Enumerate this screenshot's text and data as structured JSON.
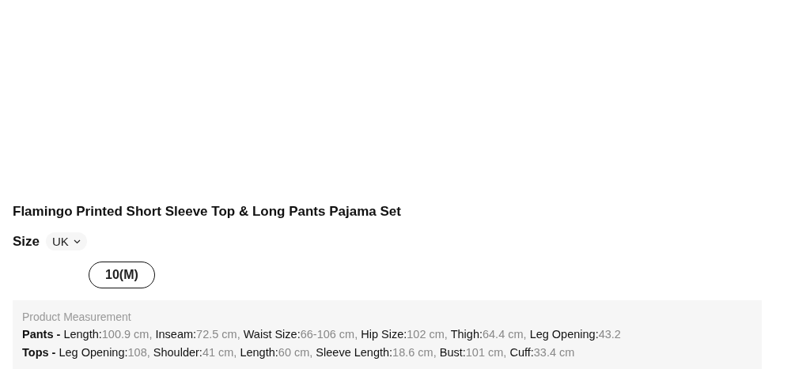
{
  "product": {
    "title": "Flamingo Printed Short Sleeve Top & Long Pants Pajama Set"
  },
  "size": {
    "label": "Size",
    "region": "UK",
    "options": [
      {
        "label": "10(M)",
        "selected": true
      }
    ]
  },
  "measurement": {
    "heading": "Product Measurement",
    "groups": [
      {
        "name": "Pants -",
        "items": [
          {
            "label": "Length:",
            "value": "100.9 cm,"
          },
          {
            "label": "Inseam:",
            "value": "72.5 cm,"
          },
          {
            "label": "Waist Size:",
            "value": "66-106 cm,"
          },
          {
            "label": "Hip Size:",
            "value": "102 cm,"
          },
          {
            "label": "Thigh:",
            "value": "64.4 cm,"
          },
          {
            "label": "Leg Opening:",
            "value": "43.2"
          }
        ]
      },
      {
        "name": "Tops -",
        "items": [
          {
            "label": "Leg Opening:",
            "value": "108,"
          },
          {
            "label": "Shoulder:",
            "value": "41 cm,"
          },
          {
            "label": "Length:",
            "value": "60 cm,"
          },
          {
            "label": "Sleeve Length:",
            "value": "18.6 cm,"
          },
          {
            "label": "Bust:",
            "value": "101 cm,"
          },
          {
            "label": "Cuff:",
            "value": "33.4 cm"
          }
        ]
      }
    ]
  }
}
